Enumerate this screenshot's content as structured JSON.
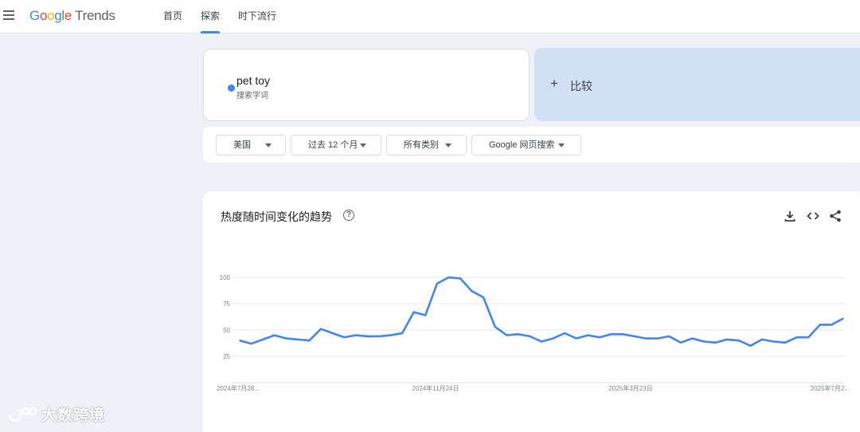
{
  "header": {
    "logo_google": "Google",
    "logo_trends": "Trends",
    "nav": [
      {
        "label": "首页"
      },
      {
        "label": "探索"
      },
      {
        "label": "时下流行"
      }
    ]
  },
  "search": {
    "term": "pet toy",
    "term_type": "搜索字词",
    "compare_label": "比较",
    "term_color": "#4285f4"
  },
  "filters": {
    "region": "美国",
    "time_range": "过去 12 个月",
    "category": "所有类别",
    "search_type": "Google 网页搜索"
  },
  "chart_card": {
    "title": "热度随时间变化的趋势"
  },
  "watermark": {
    "text": "大数跨境"
  },
  "chart_data": {
    "type": "line",
    "x_labels": [
      "2024年7月28...",
      "2024年11月24日",
      "2025年3月23日",
      "2025年7月2..."
    ],
    "y_ticks": [
      100,
      75,
      50,
      25
    ],
    "ylim": [
      0,
      100
    ],
    "series": [
      {
        "color": "#4285f4",
        "values": [
          40,
          37,
          41,
          45,
          42,
          41,
          40,
          51,
          47,
          43,
          45,
          44,
          44,
          45,
          47,
          67,
          64,
          94,
          100,
          99,
          87,
          81,
          53,
          45,
          46,
          44,
          39,
          42,
          47,
          42,
          45,
          43,
          46,
          46,
          44,
          42,
          42,
          44,
          38,
          42,
          39,
          38,
          41,
          40,
          35,
          41,
          39,
          38,
          43,
          43,
          55,
          55,
          61
        ]
      }
    ]
  }
}
